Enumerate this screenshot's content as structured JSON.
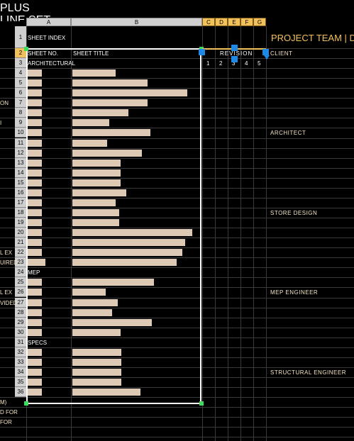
{
  "title_fragments": [
    "PLUS",
    "LINE SET"
  ],
  "left_fragments": [
    {
      "row": 7,
      "text": "ON"
    },
    {
      "row": 9,
      "text": "I"
    },
    {
      "row": 22,
      "text": "L EX"
    },
    {
      "row": 23,
      "text": "UIRED"
    },
    {
      "row": 26,
      "text": "L EX"
    },
    {
      "row": 27,
      "text": "VIDED"
    },
    {
      "row": 37,
      "text": "M)"
    },
    {
      "row": 38,
      "text": "D FOR"
    },
    {
      "row": 39,
      "text": "FOR"
    }
  ],
  "column_headers": [
    "A",
    "B",
    "C",
    "D",
    "E",
    "F",
    "G"
  ],
  "row_headers": [
    "1",
    "2",
    "3",
    "4",
    "5",
    "6",
    "7",
    "8",
    "9",
    "10",
    "11",
    "12",
    "13",
    "14",
    "15",
    "16",
    "17",
    "18",
    "19",
    "20",
    "21",
    "22",
    "23",
    "24",
    "25",
    "26",
    "27",
    "28",
    "29",
    "30",
    "31",
    "32",
    "33",
    "34",
    "35",
    "36"
  ],
  "sheet_index": {
    "title": "SHEET INDEX",
    "col_sheet_no": "SHEET NO.",
    "col_sheet_title": "SHEET TITLE",
    "revision_label": "REVISION",
    "revision_numbers": [
      "1",
      "2",
      "3",
      "4",
      "5"
    ],
    "sections": [
      {
        "label": "ARCHITECTURAL",
        "row": 3
      },
      {
        "label": "MEP",
        "row": 24
      },
      {
        "label": "SPECS",
        "row": 31
      }
    ]
  },
  "project_team": {
    "title": "PROJECT TEAM | D",
    "roles": [
      {
        "label": "CLIENT",
        "row": 2
      },
      {
        "label": "ARCHITECT",
        "row": 10
      },
      {
        "label": "STORE DESIGN",
        "row": 18
      },
      {
        "label": "MEP ENGINEER",
        "row": 26
      },
      {
        "label": "STRUCTURAL ENGINEER",
        "row": 34
      }
    ]
  },
  "colors": {
    "accent": "#f3c15c",
    "redacted_fill": "#ddc9b4",
    "selection": "#ffffff",
    "handle": "#1e88e5"
  },
  "redacted_rows": [
    {
      "row": 4,
      "no": 0.44,
      "title": 0.36
    },
    {
      "row": 5,
      "no": 0.44,
      "title": 0.63
    },
    {
      "row": 6,
      "no": 0.44,
      "title": 0.96
    },
    {
      "row": 7,
      "no": 0.44,
      "title": 0.63
    },
    {
      "row": 8,
      "no": 0.44,
      "title": 0.47
    },
    {
      "row": 9,
      "no": 0.44,
      "title": 0.31
    },
    {
      "row": 10,
      "no": 0.44,
      "title": 0.65
    },
    {
      "row": 11,
      "no": 0.44,
      "title": 0.29
    },
    {
      "row": 12,
      "no": 0.44,
      "title": 0.58
    },
    {
      "row": 13,
      "no": 0.44,
      "title": 0.4
    },
    {
      "row": 14,
      "no": 0.44,
      "title": 0.4
    },
    {
      "row": 15,
      "no": 0.44,
      "title": 0.4
    },
    {
      "row": 16,
      "no": 0.44,
      "title": 0.45
    },
    {
      "row": 17,
      "no": 0.44,
      "title": 0.36
    },
    {
      "row": 18,
      "no": 0.44,
      "title": 0.39
    },
    {
      "row": 19,
      "no": 0.44,
      "title": 0.39
    },
    {
      "row": 20,
      "no": 0.44,
      "title": 1.0
    },
    {
      "row": 21,
      "no": 0.44,
      "title": 0.94
    },
    {
      "row": 22,
      "no": 0.44,
      "title": 0.92
    },
    {
      "row": 23,
      "no": 0.56,
      "title": 0.87
    },
    {
      "row": 25,
      "no": 0.44,
      "title": 0.68
    },
    {
      "row": 26,
      "no": 0.44,
      "title": 0.28
    },
    {
      "row": 27,
      "no": 0.44,
      "title": 0.38
    },
    {
      "row": 28,
      "no": 0.44,
      "title": 0.33
    },
    {
      "row": 29,
      "no": 0.44,
      "title": 0.66
    },
    {
      "row": 30,
      "no": 0.44,
      "title": 0.4
    },
    {
      "row": 32,
      "no": 0.44,
      "title": 0.41
    },
    {
      "row": 33,
      "no": 0.44,
      "title": 0.41
    },
    {
      "row": 34,
      "no": 0.44,
      "title": 0.41
    },
    {
      "row": 35,
      "no": 0.44,
      "title": 0.41
    },
    {
      "row": 36,
      "no": 0.44,
      "title": 0.57
    }
  ]
}
